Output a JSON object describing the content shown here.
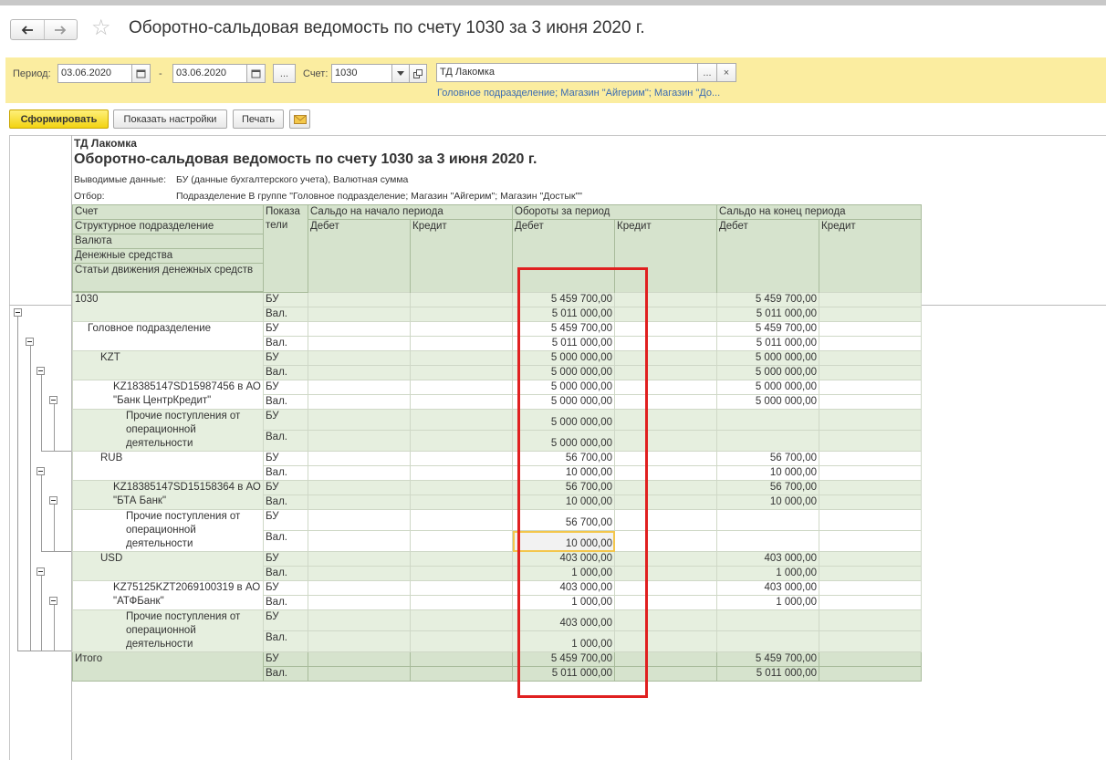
{
  "window": {
    "title": "Оборотно-сальдовая ведомость по счету 1030  за 3 июня 2020 г."
  },
  "nav": {
    "back_icon": "arrow-left-icon",
    "forward_icon": "arrow-right-icon",
    "favorite_icon": "star-icon"
  },
  "params": {
    "period_label": "Период:",
    "date_from": "03.06.2020",
    "dash": "-",
    "date_to": "03.06.2020",
    "more_label": "...",
    "account_label": "Счет:",
    "account_value": "1030",
    "org_value": "ТД Лакомка",
    "org_more_label": "...",
    "org_clear_label": "×",
    "selection_link": "Головное подразделение; Магазин \"Айгерим\"; Магазин \"До..."
  },
  "toolbar": {
    "generate_label": "Сформировать",
    "settings_label": "Показать настройки",
    "print_label": "Печать"
  },
  "report": {
    "org": "ТД Лакомка",
    "title": "Оборотно-сальдовая ведомость по счету 1030  за 3 июня 2020 г.",
    "output_label": "Выводимые данные:",
    "output_value": "БУ (данные бухгалтерского учета), Валютная сумма",
    "filter_label": "Отбор:",
    "filter_value": "Подразделение В группе \"Головное подразделение; Магазин \"Айгерим\"; Магазин \"Достык\"\"",
    "headers": {
      "account": "Счет",
      "indicators": "Показа тели",
      "opening": "Сальдо на начало периода",
      "turnover": "Обороты за период",
      "closing": "Сальдо на конец периода",
      "debit": "Дебет",
      "credit": "Кредит",
      "dimensions": [
        "Структурное подразделение",
        "Валюта",
        "Денежные средства",
        "Статьи движения денежных средств"
      ]
    },
    "rows": [
      {
        "name": "1030",
        "ind": "БУ",
        "turn_debit": "5 459 700,00",
        "close_debit": "5 459 700,00"
      },
      {
        "name": "",
        "ind": "Вал.",
        "turn_debit": "5 011 000,00",
        "close_debit": "5 011 000,00"
      },
      {
        "name": "Головное подразделение",
        "ind": "БУ",
        "turn_debit": "5 459 700,00",
        "close_debit": "5 459 700,00"
      },
      {
        "name": "",
        "ind": "Вал.",
        "turn_debit": "5 011 000,00",
        "close_debit": "5 011 000,00"
      },
      {
        "name": "KZT",
        "ind": "БУ",
        "turn_debit": "5 000 000,00",
        "close_debit": "5 000 000,00"
      },
      {
        "name": "",
        "ind": "Вал.",
        "turn_debit": "5 000 000,00",
        "close_debit": "5 000 000,00"
      },
      {
        "name": "KZ18385147SD15987456 в АО \"Банк ЦентрКредит\"",
        "ind": "БУ",
        "turn_debit": "5 000 000,00",
        "close_debit": "5 000 000,00"
      },
      {
        "name": "",
        "ind": "Вал.",
        "turn_debit": "5 000 000,00",
        "close_debit": "5 000 000,00"
      },
      {
        "name": "Прочие поступления от операционной деятельности",
        "ind": "БУ",
        "turn_debit": "5 000 000,00",
        "close_debit": ""
      },
      {
        "name": "",
        "ind": "Вал.",
        "turn_debit": "5 000 000,00",
        "close_debit": ""
      },
      {
        "name": "RUB",
        "ind": "БУ",
        "turn_debit": "56 700,00",
        "close_debit": "56 700,00"
      },
      {
        "name": "",
        "ind": "Вал.",
        "turn_debit": "10 000,00",
        "close_debit": "10 000,00"
      },
      {
        "name": "KZ18385147SD15158364 в АО \"БТА Банк\"",
        "ind": "БУ",
        "turn_debit": "56 700,00",
        "close_debit": "56 700,00"
      },
      {
        "name": "",
        "ind": "Вал.",
        "turn_debit": "10 000,00",
        "close_debit": "10 000,00"
      },
      {
        "name": "Прочие поступления от операционной деятельности",
        "ind": "БУ",
        "turn_debit": "56 700,00",
        "close_debit": ""
      },
      {
        "name": "",
        "ind": "Вал.",
        "turn_debit": "10 000,00",
        "close_debit": ""
      },
      {
        "name": "USD",
        "ind": "БУ",
        "turn_debit": "403 000,00",
        "close_debit": "403 000,00"
      },
      {
        "name": "",
        "ind": "Вал.",
        "turn_debit": "1 000,00",
        "close_debit": "1 000,00"
      },
      {
        "name": "KZ75125KZT2069100319 в АО \"АТФБанк\"",
        "ind": "БУ",
        "turn_debit": "403 000,00",
        "close_debit": "403 000,00"
      },
      {
        "name": "",
        "ind": "Вал.",
        "turn_debit": "1 000,00",
        "close_debit": "1 000,00"
      },
      {
        "name": "Прочие поступления от операционной деятельности",
        "ind": "БУ",
        "turn_debit": "403 000,00",
        "close_debit": ""
      },
      {
        "name": "",
        "ind": "Вал.",
        "turn_debit": "1 000,00",
        "close_debit": ""
      },
      {
        "name": "Итого",
        "ind": "БУ",
        "turn_debit": "5 459 700,00",
        "close_debit": "5 459 700,00"
      },
      {
        "name": "",
        "ind": "Вал.",
        "turn_debit": "5 011 000,00",
        "close_debit": "5 011 000,00"
      }
    ]
  },
  "colors": {
    "param_panel_bg": "#fbeda0",
    "header_green": "#d6e3cd",
    "row_green": "#e6efdf",
    "highlight_red": "#e02020",
    "selected_cell": "#f3c64c"
  }
}
